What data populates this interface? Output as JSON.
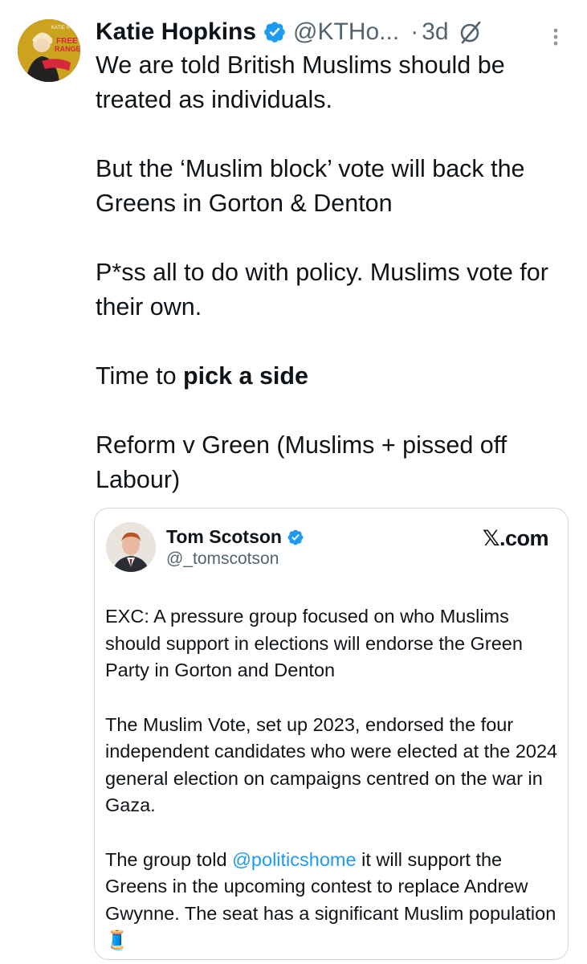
{
  "tweet": {
    "display_name": "Katie Hopkins",
    "handle": "@KTHo...",
    "separator": "·",
    "time": "3d",
    "paragraphs": [
      "We are told British Muslims should be treated as individuals.",
      "But the ‘Muslim block’ vote will back the Greens in Gorton & Denton",
      "P*ss all to do with policy. Muslims vote for their own."
    ],
    "p4_prefix": "Time to ",
    "p4_bold": "pick a side",
    "p5": "Reform v Green (Muslims + pissed off Labour)",
    "avatar_text_top": "KATIE H",
    "avatar_text_main": "FREE RANGE"
  },
  "quote": {
    "display_name": "Tom Scotson",
    "handle": "@_tomscotson",
    "source": "𝕏.com",
    "p1": "EXC: A pressure group focused on who Muslims should support in elections will endorse the Green Party in Gorton and Denton",
    "p2": "The Muslim Vote, set up 2023, endorsed the four independent candidates who were elected at the 2024 general election on campaigns centred on the war in Gaza.",
    "p3_prefix": "The group told ",
    "p3_mention": "@politicshome",
    "p3_suffix": " it will support the Greens in the upcoming contest to replace Andrew Gwynne. The seat has a significant Muslim population",
    "p3_emoji": "🧵"
  },
  "colors": {
    "text": "#0f1419",
    "secondary": "#536471",
    "link": "#1d9bf0",
    "border": "#cfd9de"
  }
}
